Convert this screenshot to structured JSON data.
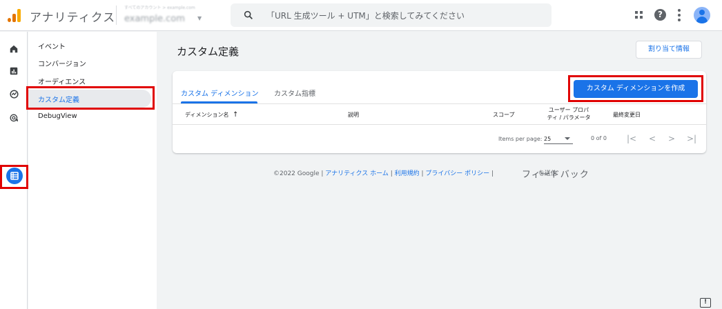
{
  "header": {
    "app_title": "アナリティクス",
    "account_sub": "すべてのアカウント > example.com",
    "account_main": "example.com",
    "search_placeholder": "「URL 生成ツール + UTM」と検索してみてください",
    "help_glyph": "?"
  },
  "rail": {
    "items": [
      "home-icon",
      "reports-icon",
      "explore-icon",
      "advertising-icon",
      "configure-icon"
    ]
  },
  "subnav": {
    "items": [
      {
        "label": "イベント"
      },
      {
        "label": "コンバージョン"
      },
      {
        "label": "オーディエンス"
      },
      {
        "label": "カスタム定義"
      },
      {
        "label": "DebugView"
      }
    ],
    "active_index": 3
  },
  "main": {
    "page_title": "カスタム定義",
    "assign_button": "割り当て情報",
    "tabs": [
      {
        "label": "カスタム ディメンション"
      },
      {
        "label": "カスタム指標"
      }
    ],
    "create_button": "カスタム ディメンションを作成",
    "table": {
      "columns": {
        "name": "ディメンション名",
        "name_sort": "↑",
        "description": "説明",
        "scope": "スコープ",
        "user_property_l1": "ユーザー プロパ",
        "user_property_l2": "ティ / パラメータ",
        "last_modified": "最終変更日"
      }
    },
    "pagination": {
      "items_per_page_label": "Items per page:",
      "items_per_page": "25",
      "range": "0 of 0",
      "first": "|<",
      "prev": "<",
      "next": ">",
      "last": ">|"
    }
  },
  "footer": {
    "copyright": "©2022 Google | ",
    "links": [
      "アナリティクス ホーム",
      "利用規約",
      "プライバシー ポリシー"
    ],
    "sep": " | ",
    "feedback_overlay": "フィードバック",
    "feedback_suffix": "を送信"
  },
  "colors": {
    "accent": "#1a73e8",
    "highlight": "#e00000"
  }
}
